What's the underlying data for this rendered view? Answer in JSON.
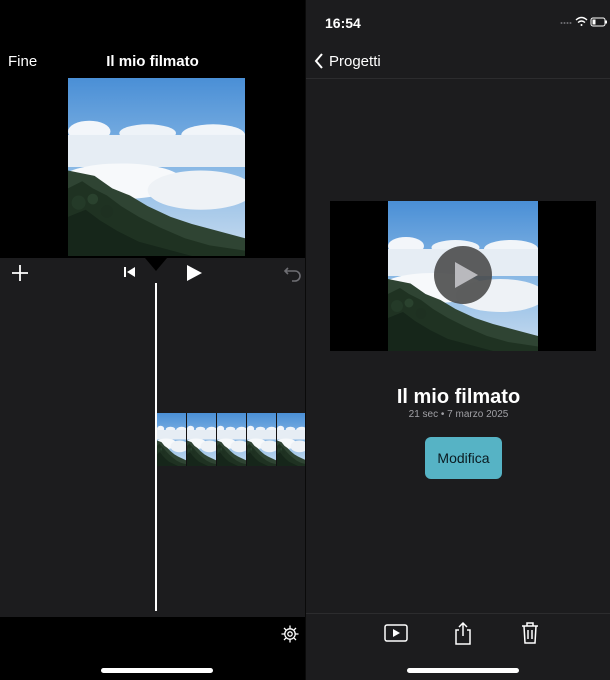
{
  "editor": {
    "done_label": "Fine",
    "title": "Il mio filmato",
    "icons": {
      "add": "plus-icon",
      "skip": "skip-to-start-icon",
      "play": "play-icon",
      "undo": "undo-icon",
      "settings": "gear-icon"
    }
  },
  "project": {
    "status_time": "16:54",
    "back_label": "Progetti",
    "title": "Il mio filmato",
    "meta": "21 sec • 7 marzo 2025",
    "edit_label": "Modifica",
    "accent_color": "#56b3c5",
    "toolbar_icons": [
      "play-rectangle-icon",
      "share-icon",
      "trash-icon"
    ]
  }
}
